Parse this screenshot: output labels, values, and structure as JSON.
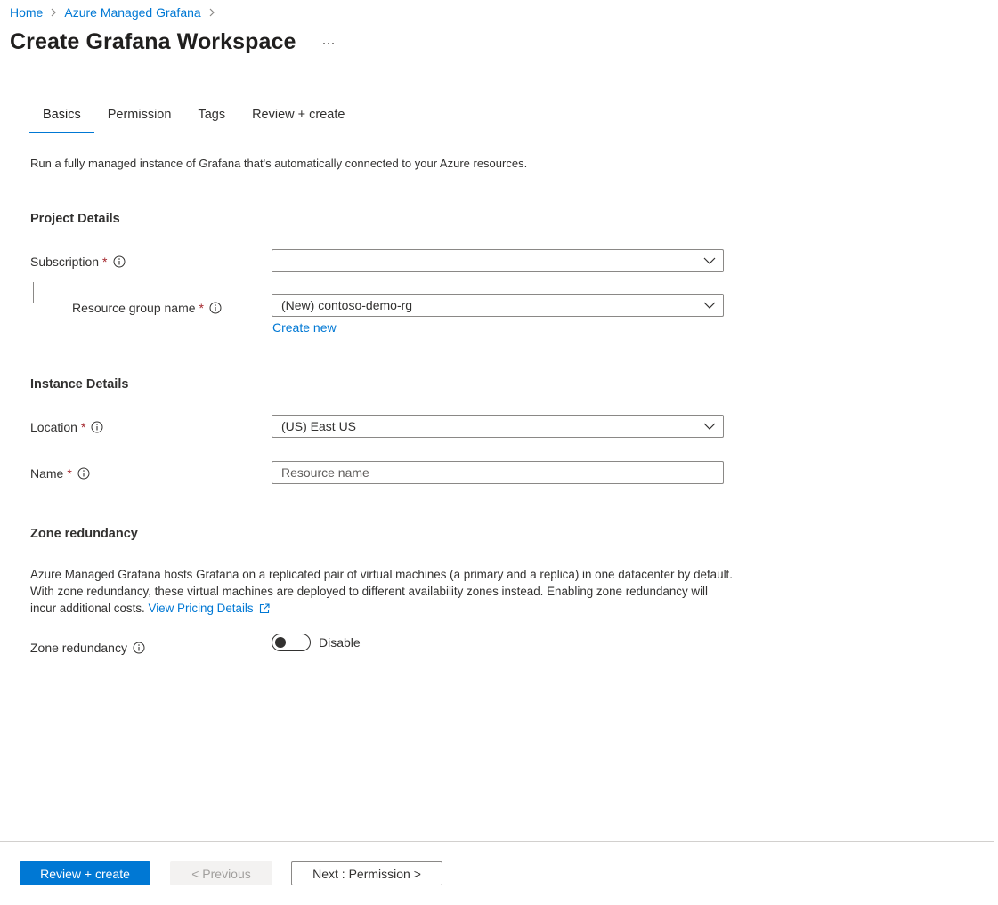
{
  "breadcrumb": {
    "items": [
      {
        "label": "Home"
      },
      {
        "label": "Azure Managed Grafana"
      }
    ]
  },
  "header": {
    "title": "Create Grafana Workspace",
    "more_label": "..."
  },
  "tabs": [
    {
      "label": "Basics",
      "active": true
    },
    {
      "label": "Permission",
      "active": false
    },
    {
      "label": "Tags",
      "active": false
    },
    {
      "label": "Review + create",
      "active": false
    }
  ],
  "intro": "Run a fully managed instance of Grafana that's automatically connected to your Azure resources.",
  "project_details": {
    "heading": "Project Details",
    "subscription": {
      "label": "Subscription",
      "required_mark": "*",
      "value": ""
    },
    "resource_group": {
      "label": "Resource group name",
      "required_mark": "*",
      "value": "(New) contoso-demo-rg",
      "create_new": "Create new"
    }
  },
  "instance_details": {
    "heading": "Instance Details",
    "location": {
      "label": "Location",
      "required_mark": "*",
      "value": "(US) East US"
    },
    "name": {
      "label": "Name",
      "required_mark": "*",
      "value": "",
      "placeholder": "Resource name"
    }
  },
  "zone_redundancy": {
    "heading": "Zone redundancy",
    "description": "Azure Managed Grafana hosts Grafana on a replicated pair of virtual machines (a primary and a replica) in one datacenter by default. With zone redundancy, these virtual machines are deployed to different availability zones instead. Enabling zone redundancy will incur additional costs.",
    "pricing_link": "View Pricing Details",
    "field_label": "Zone redundancy",
    "toggle_state": "Disable"
  },
  "footer": {
    "review_create": "Review + create",
    "previous": "< Previous",
    "next": "Next : Permission >"
  },
  "colors": {
    "accent": "#0078d4",
    "required": "#a4262c",
    "text": "#323130"
  }
}
